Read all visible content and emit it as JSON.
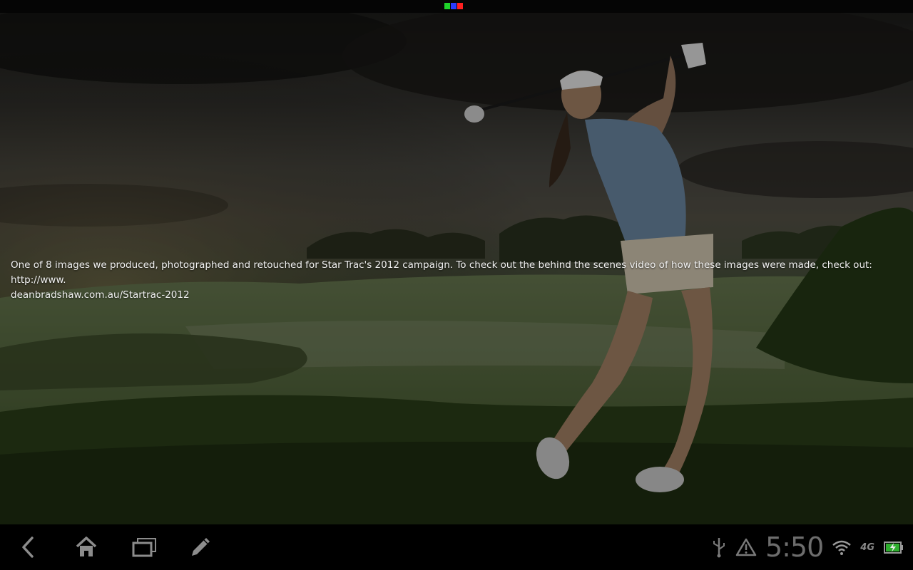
{
  "caption": {
    "line1": "One of 8 images we produced, photographed and retouched for Star Trac's 2012 campaign. To check out the behind the scenes video of how these images were made, check out: http://www.",
    "line2": "deanbradshaw.com.au/Startrac-2012"
  },
  "status_bar": {
    "time": "5:50",
    "network": "4G",
    "icons": [
      "usb-icon",
      "warning-icon",
      "wifi-icon",
      "battery-charging-icon"
    ]
  },
  "nav_bar": {
    "buttons": [
      "back-icon",
      "home-icon",
      "recent-apps-icon",
      "edit-icon"
    ]
  },
  "colors": {
    "indicator_green": "#1fd32a",
    "indicator_blue": "#2a3cff",
    "indicator_red": "#ff2020",
    "nav_icon": "#8c8c8c"
  }
}
